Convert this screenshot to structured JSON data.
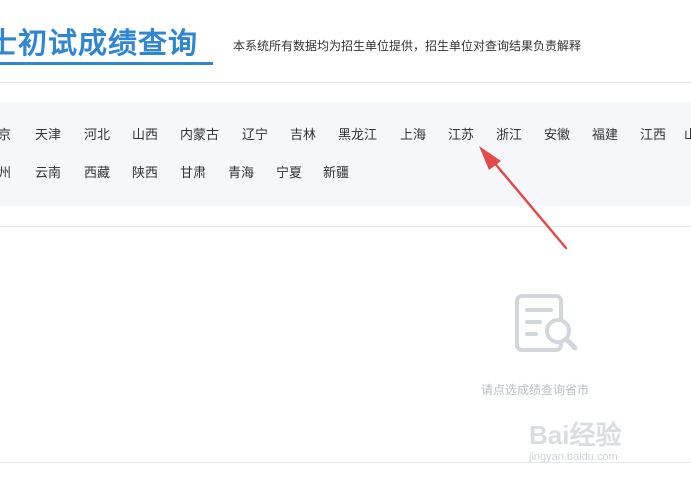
{
  "header": {
    "title": "士初试成绩查询",
    "subtitle": "本系统所有数据均为招生单位提供，招生单位对查询结果负责解释"
  },
  "provinces": {
    "row1": [
      "京",
      "天津",
      "河北",
      "山西",
      "内蒙古",
      "辽宁",
      "吉林",
      "黑龙江",
      "上海",
      "江苏",
      "浙江",
      "安徽",
      "福建",
      "江西",
      "山"
    ],
    "row2": [
      "州",
      "云南",
      "西藏",
      "陕西",
      "甘肃",
      "青海",
      "宁夏",
      "新疆"
    ]
  },
  "empty_state": {
    "icon": "document-search-icon",
    "hint": "请点选成绩查询省市"
  },
  "annotation": {
    "arrow_color": "#e34a4a"
  },
  "watermark": {
    "brand": "Bai经验",
    "url": "jingyan.baidu.com"
  }
}
